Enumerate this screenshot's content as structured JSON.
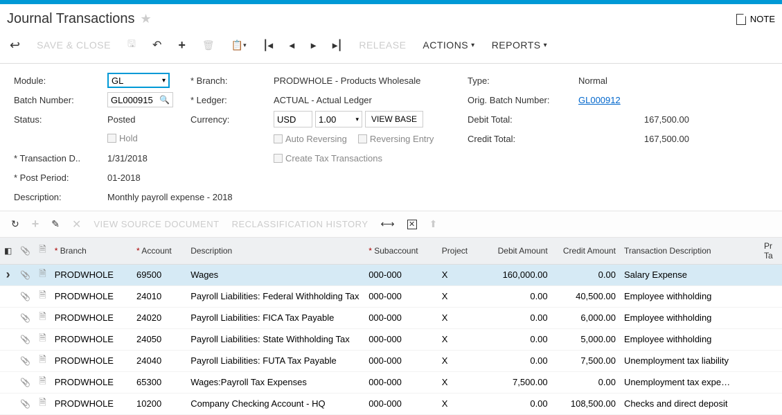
{
  "page": {
    "title": "Journal Transactions",
    "notes_label": "NOTE"
  },
  "toolbar": {
    "save_close": "SAVE & CLOSE",
    "release": "RELEASE",
    "actions": "ACTIONS",
    "reports": "REPORTS"
  },
  "form": {
    "module_label": "Module:",
    "module_value": "GL",
    "batch_label": "Batch Number:",
    "batch_value": "GL000915",
    "status_label": "Status:",
    "status_value": "Posted",
    "hold_label": "Hold",
    "tdate_label": "Transaction D..",
    "tdate_value": "1/31/2018",
    "pperiod_label": "Post Period:",
    "pperiod_value": "01-2018",
    "desc_label": "Description:",
    "desc_value": "Monthly payroll expense - 2018",
    "branch_label": "Branch:",
    "branch_value": "PRODWHOLE - Products Wholesale",
    "ledger_label": "Ledger:",
    "ledger_value": "ACTUAL - Actual Ledger",
    "currency_label": "Currency:",
    "currency_code": "USD",
    "currency_rate": "1.00",
    "view_base": "VIEW BASE",
    "auto_rev": "Auto Reversing",
    "rev_entry": "Reversing Entry",
    "create_tax": "Create Tax Transactions",
    "type_label": "Type:",
    "type_value": "Normal",
    "orig_batch_label": "Orig. Batch Number:",
    "orig_batch_value": "GL000912",
    "debit_total_label": "Debit Total:",
    "debit_total_value": "167,500.00",
    "credit_total_label": "Credit Total:",
    "credit_total_value": "167,500.00"
  },
  "grid_toolbar": {
    "view_source": "VIEW SOURCE DOCUMENT",
    "reclass": "RECLASSIFICATION HISTORY"
  },
  "grid": {
    "headers": {
      "branch": "Branch",
      "account": "Account",
      "description": "Description",
      "subaccount": "Subaccount",
      "project": "Project",
      "debit": "Debit Amount",
      "credit": "Credit Amount",
      "tdesc": "Transaction Description",
      "ptax": "Project Task"
    },
    "rows": [
      {
        "branch": "PRODWHOLE",
        "account": "69500",
        "description": "Wages",
        "sub": "000-000",
        "project": "X",
        "debit": "160,000.00",
        "credit": "0.00",
        "tdesc": "Salary Expense",
        "sel": true
      },
      {
        "branch": "PRODWHOLE",
        "account": "24010",
        "description": "Payroll Liabilities: Federal Withholding Tax",
        "sub": "000-000",
        "project": "X",
        "debit": "0.00",
        "credit": "40,500.00",
        "tdesc": "Employee withholding"
      },
      {
        "branch": "PRODWHOLE",
        "account": "24020",
        "description": "Payroll Liabilities: FICA Tax Payable",
        "sub": "000-000",
        "project": "X",
        "debit": "0.00",
        "credit": "6,000.00",
        "tdesc": "Employee withholding"
      },
      {
        "branch": "PRODWHOLE",
        "account": "24050",
        "description": "Payroll Liabilities: State Withholding Tax",
        "sub": "000-000",
        "project": "X",
        "debit": "0.00",
        "credit": "5,000.00",
        "tdesc": "Employee withholding"
      },
      {
        "branch": "PRODWHOLE",
        "account": "24040",
        "description": "Payroll Liabilities: FUTA Tax Payable",
        "sub": "000-000",
        "project": "X",
        "debit": "0.00",
        "credit": "7,500.00",
        "tdesc": "Unemployment tax liability"
      },
      {
        "branch": "PRODWHOLE",
        "account": "65300",
        "description": "Wages:Payroll Tax Expenses",
        "sub": "000-000",
        "project": "X",
        "debit": "7,500.00",
        "credit": "0.00",
        "tdesc": "Unemployment tax expe…"
      },
      {
        "branch": "PRODWHOLE",
        "account": "10200",
        "description": "Company Checking Account - HQ",
        "sub": "000-000",
        "project": "X",
        "debit": "0.00",
        "credit": "108,500.00",
        "tdesc": "Checks and direct deposit"
      }
    ]
  }
}
